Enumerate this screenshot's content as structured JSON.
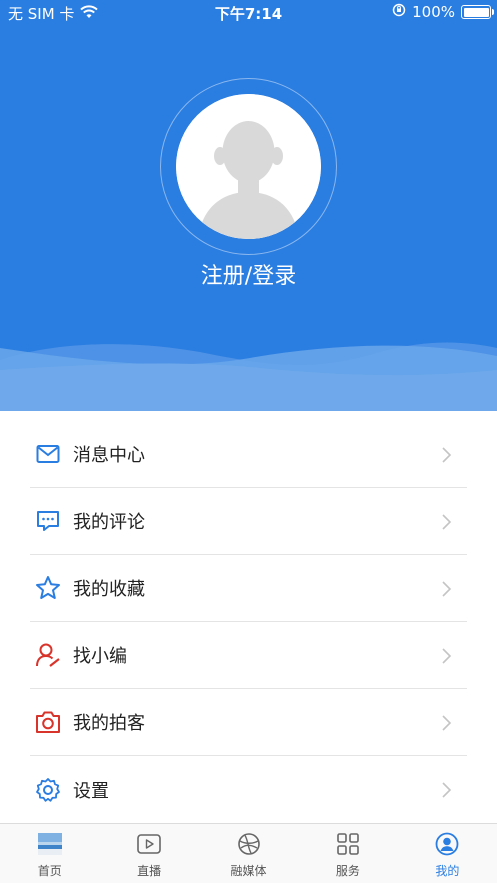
{
  "status_bar": {
    "carrier": "无 SIM 卡",
    "time": "下午7:14",
    "battery": "100%"
  },
  "profile": {
    "login_label": "注册/登录"
  },
  "menu": {
    "items": [
      {
        "label": "消息中心",
        "icon": "mail-icon"
      },
      {
        "label": "我的评论",
        "icon": "comment-icon"
      },
      {
        "label": "我的收藏",
        "icon": "star-icon"
      },
      {
        "label": "找小编",
        "icon": "editor-icon"
      },
      {
        "label": "我的拍客",
        "icon": "camera-icon"
      },
      {
        "label": "设置",
        "icon": "settings-icon"
      }
    ]
  },
  "tabbar": {
    "tabs": [
      {
        "label": "首页",
        "icon": "home-thumbnail-icon"
      },
      {
        "label": "直播",
        "icon": "play-icon"
      },
      {
        "label": "融媒体",
        "icon": "media-globe-icon"
      },
      {
        "label": "服务",
        "icon": "grid-icon"
      },
      {
        "label": "我的",
        "icon": "profile-icon"
      }
    ],
    "active_index": 4
  },
  "colors": {
    "brand_blue": "#2a7de1",
    "wave_light": "#6aa7ea",
    "red_icon": "#d9342b"
  }
}
